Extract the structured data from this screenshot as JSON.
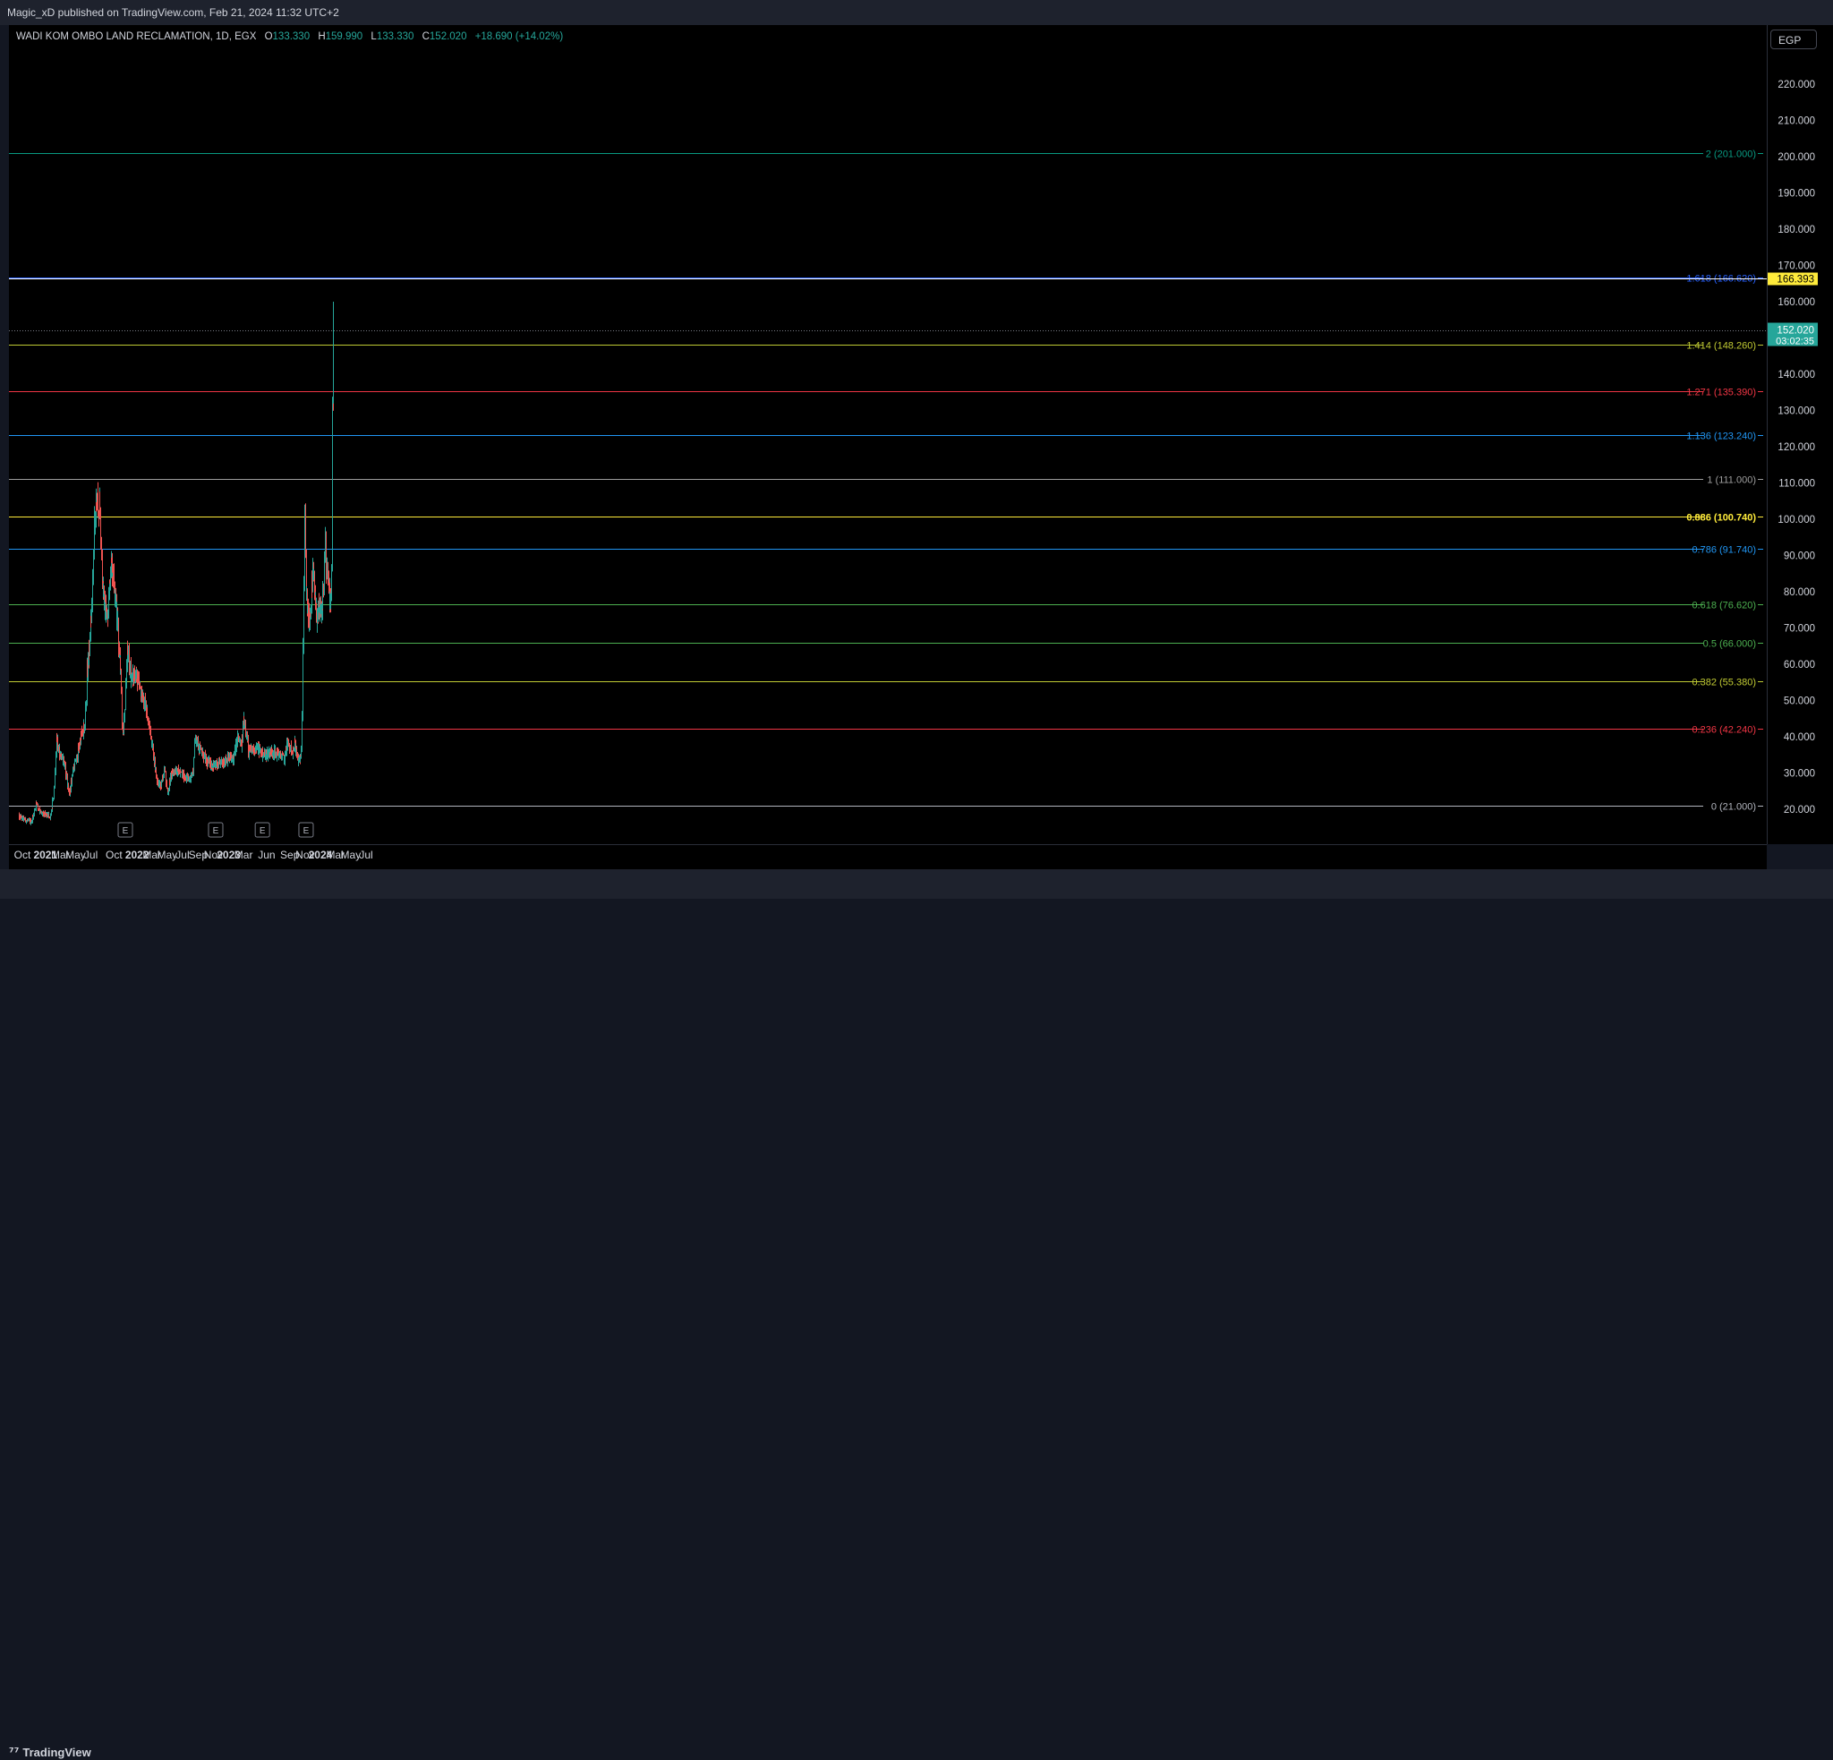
{
  "header": {
    "published": "Magic_xD published on TradingView.com, Feb 21, 2024 11:32 UTC+2"
  },
  "legend": {
    "symbol": "WADI KOM OMBO LAND RECLAMATION, 1D, EGX",
    "open_label": "O",
    "open": "133.330",
    "high_label": "H",
    "high": "159.990",
    "low_label": "L",
    "low": "133.330",
    "close_label": "C",
    "close": "152.020",
    "change": "+18.690 (+14.02%)"
  },
  "currency": "EGP",
  "footer": {
    "brand": "TradingView",
    "logo": "tradingview-logo-icon"
  },
  "colors": {
    "up": "#26a69a",
    "down": "#ef5350",
    "background": "#000000",
    "panel": "#1e222d"
  },
  "chart_data": {
    "type": "candlestick",
    "title": "WADI KOM OMBO LAND RECLAMATION, 1D, EGX",
    "ylim": [
      15,
      240
    ],
    "y_ticks": [
      20,
      30,
      40,
      50,
      60,
      70,
      80,
      90,
      100,
      110,
      120,
      130,
      140,
      150,
      160,
      170,
      180,
      190,
      200,
      210,
      220
    ],
    "y_tick_labels": [
      "20.000",
      "30.000",
      "40.000",
      "50.000",
      "60.000",
      "70.000",
      "80.000",
      "90.000",
      "100.000",
      "110.000",
      "120.000",
      "130.000",
      "140.000",
      "150.000",
      "160.000",
      "170.000",
      "180.000",
      "190.000",
      "200.000",
      "210.000",
      "220.000"
    ],
    "x_labels": [
      {
        "label": "Oct",
        "date": "2020-10-01",
        "bold": false
      },
      {
        "label": "2021",
        "date": "2021-01-01",
        "bold": true
      },
      {
        "label": "Mar",
        "date": "2021-03-01",
        "bold": false
      },
      {
        "label": "May",
        "date": "2021-05-01",
        "bold": false
      },
      {
        "label": "Jul",
        "date": "2021-07-01",
        "bold": false
      },
      {
        "label": "Oct",
        "date": "2021-10-01",
        "bold": false
      },
      {
        "label": "2022",
        "date": "2022-01-01",
        "bold": true
      },
      {
        "label": "Mar",
        "date": "2022-03-01",
        "bold": false
      },
      {
        "label": "May",
        "date": "2022-05-01",
        "bold": false
      },
      {
        "label": "Jul",
        "date": "2022-07-01",
        "bold": false
      },
      {
        "label": "Sep",
        "date": "2022-09-01",
        "bold": false
      },
      {
        "label": "Nov",
        "date": "2022-11-01",
        "bold": false
      },
      {
        "label": "2023",
        "date": "2023-01-01",
        "bold": true
      },
      {
        "label": "Mar",
        "date": "2023-03-01",
        "bold": false
      },
      {
        "label": "Jun",
        "date": "2023-06-01",
        "bold": false
      },
      {
        "label": "Sep",
        "date": "2023-09-01",
        "bold": false
      },
      {
        "label": "Nov",
        "date": "2023-11-01",
        "bold": false
      },
      {
        "label": "2024",
        "date": "2024-01-01",
        "bold": true
      },
      {
        "label": "Mar",
        "date": "2024-03-01",
        "bold": false
      },
      {
        "label": "May",
        "date": "2024-05-01",
        "bold": false
      },
      {
        "label": "Jul",
        "date": "2024-07-01",
        "bold": false
      }
    ],
    "fib_levels": [
      {
        "ratio": "0",
        "value": 21.0,
        "label": "0 (21.000)",
        "color": "#b2b5be"
      },
      {
        "ratio": "0.236",
        "value": 42.24,
        "label": "0.236 (42.240)",
        "color": "#f23645"
      },
      {
        "ratio": "0.382",
        "value": 55.38,
        "label": "0.382 (55.380)",
        "color": "#c0ca33"
      },
      {
        "ratio": "0.5",
        "value": 66.0,
        "label": "0.5 (66.000)",
        "color": "#4caf50"
      },
      {
        "ratio": "0.618",
        "value": 76.62,
        "label": "0.618 (76.620)",
        "color": "#4caf50"
      },
      {
        "ratio": "0.786",
        "value": 91.74,
        "label": "0.786 (91.740)",
        "color": "#2196f3"
      },
      {
        "ratio": "0.886",
        "value": 100.74,
        "label": "0.886 (100.740)",
        "color": "#ffeb3b"
      },
      {
        "ratio": "1",
        "value": 111.0,
        "label": "1 (111.000)",
        "color": "#9e9e9e"
      },
      {
        "ratio": "1.136",
        "value": 123.24,
        "label": "1.136 (123.240)",
        "color": "#2196f3"
      },
      {
        "ratio": "1.271",
        "value": 135.39,
        "label": "1.271 (135.390)",
        "color": "#f23645"
      },
      {
        "ratio": "1.414",
        "value": 148.26,
        "label": "1.414 (148.260)",
        "color": "#c0ca33"
      },
      {
        "ratio": "1.618",
        "value": 166.62,
        "label": "1.618 (166.620)",
        "color": "#2962ff"
      },
      {
        "ratio": "2",
        "value": 201.0,
        "label": "2 (201.000)",
        "color": "#089981"
      }
    ],
    "horizontal_line": {
      "value": 166.393,
      "label": "166.393",
      "color": "#ffffff",
      "badge_color": "#ffeb3b"
    },
    "last_price": {
      "value": 152.02,
      "label": "152.020",
      "countdown": "03:02:35",
      "color": "#26a69a"
    },
    "earnings_markers": [
      {
        "label": "E",
        "date": "2021-11-15"
      },
      {
        "label": "E",
        "date": "2022-11-10"
      },
      {
        "label": "E",
        "date": "2023-05-15"
      },
      {
        "label": "E",
        "date": "2023-11-05"
      }
    ],
    "price_path": [
      [
        "2020-09-15",
        18
      ],
      [
        "2020-10-15",
        17
      ],
      [
        "2020-11-05",
        16.5
      ],
      [
        "2020-11-25",
        22
      ],
      [
        "2020-12-10",
        19
      ],
      [
        "2020-12-30",
        18.5
      ],
      [
        "2021-01-20",
        18
      ],
      [
        "2021-02-05",
        26
      ],
      [
        "2021-02-15",
        40
      ],
      [
        "2021-02-22",
        36
      ],
      [
        "2021-03-10",
        34
      ],
      [
        "2021-03-25",
        29
      ],
      [
        "2021-04-05",
        24
      ],
      [
        "2021-04-20",
        31
      ],
      [
        "2021-05-05",
        34
      ],
      [
        "2021-05-20",
        40
      ],
      [
        "2021-06-05",
        43
      ],
      [
        "2021-06-15",
        58
      ],
      [
        "2021-06-25",
        65
      ],
      [
        "2021-07-05",
        80
      ],
      [
        "2021-07-15",
        100
      ],
      [
        "2021-07-25",
        106
      ],
      [
        "2021-08-05",
        102
      ],
      [
        "2021-08-15",
        84
      ],
      [
        "2021-08-25",
        75
      ],
      [
        "2021-09-05",
        72
      ],
      [
        "2021-09-15",
        88
      ],
      [
        "2021-09-25",
        86
      ],
      [
        "2021-10-05",
        80
      ],
      [
        "2021-10-15",
        70
      ],
      [
        "2021-10-25",
        60
      ],
      [
        "2021-11-05",
        38
      ],
      [
        "2021-11-12",
        48
      ],
      [
        "2021-11-20",
        65
      ],
      [
        "2021-11-28",
        60
      ],
      [
        "2021-12-10",
        56
      ],
      [
        "2021-12-25",
        58
      ],
      [
        "2022-01-05",
        55
      ],
      [
        "2022-01-15",
        52
      ],
      [
        "2022-01-25",
        50
      ],
      [
        "2022-02-05",
        48
      ],
      [
        "2022-02-20",
        42
      ],
      [
        "2022-03-05",
        36
      ],
      [
        "2022-03-20",
        28
      ],
      [
        "2022-04-05",
        26
      ],
      [
        "2022-04-20",
        32
      ],
      [
        "2022-05-01",
        24
      ],
      [
        "2022-05-12",
        29
      ],
      [
        "2022-06-01",
        31
      ],
      [
        "2022-06-20",
        30
      ],
      [
        "2022-07-10",
        29
      ],
      [
        "2022-07-25",
        28
      ],
      [
        "2022-08-10",
        30
      ],
      [
        "2022-08-20",
        40
      ],
      [
        "2022-09-10",
        36
      ],
      [
        "2022-10-05",
        33
      ],
      [
        "2022-11-10",
        32
      ],
      [
        "2022-12-05",
        33
      ],
      [
        "2022-12-31",
        34
      ],
      [
        "2023-01-20",
        34
      ],
      [
        "2023-02-05",
        40
      ],
      [
        "2023-02-20",
        37
      ],
      [
        "2023-03-01",
        45
      ],
      [
        "2023-03-10",
        42
      ],
      [
        "2023-03-20",
        36
      ],
      [
        "2023-04-20",
        37
      ],
      [
        "2023-05-20",
        35
      ],
      [
        "2023-06-20",
        36
      ],
      [
        "2023-07-20",
        35
      ],
      [
        "2023-08-10",
        34
      ],
      [
        "2023-08-20",
        38
      ],
      [
        "2023-09-10",
        36
      ],
      [
        "2023-09-20",
        38
      ],
      [
        "2023-10-05",
        33
      ],
      [
        "2023-10-15",
        35
      ],
      [
        "2023-10-20",
        48
      ],
      [
        "2023-10-25",
        78
      ],
      [
        "2023-10-30",
        98
      ],
      [
        "2023-11-05",
        78
      ],
      [
        "2023-11-12",
        72
      ],
      [
        "2023-11-20",
        73
      ],
      [
        "2023-12-01",
        86
      ],
      [
        "2023-12-15",
        72
      ],
      [
        "2023-12-25",
        75
      ],
      [
        "2024-01-05",
        74
      ],
      [
        "2024-01-15",
        86
      ],
      [
        "2024-01-20",
        96
      ],
      [
        "2024-01-25",
        86
      ],
      [
        "2024-02-05",
        80
      ],
      [
        "2024-02-10",
        77
      ],
      [
        "2024-02-13",
        82
      ],
      [
        "2024-02-15",
        92
      ],
      [
        "2024-02-18",
        133
      ],
      [
        "2024-02-20",
        136
      ],
      [
        "2024-02-21",
        152
      ]
    ]
  }
}
